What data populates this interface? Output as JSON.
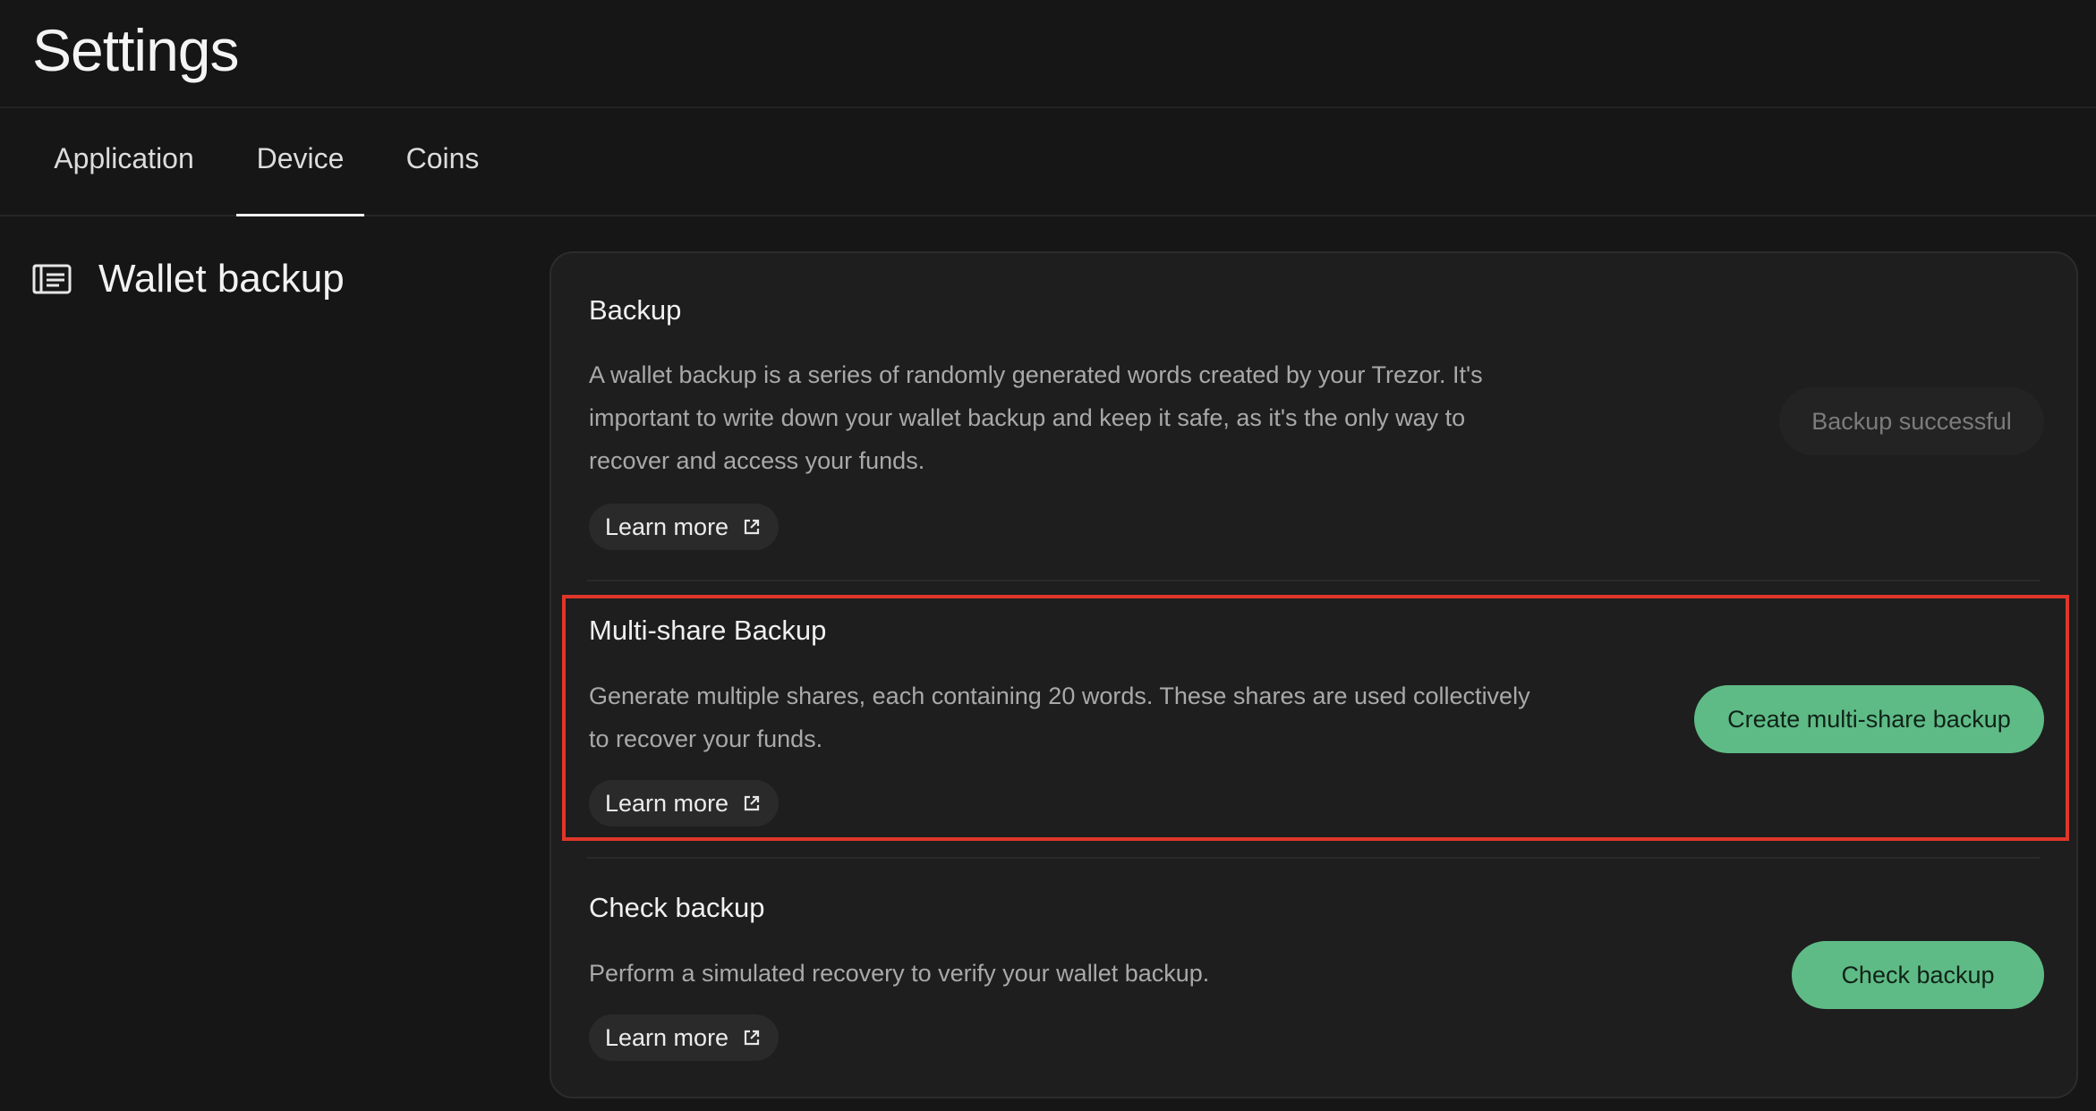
{
  "header": {
    "title": "Settings"
  },
  "tabs": [
    {
      "label": "Application",
      "active": false
    },
    {
      "label": "Device",
      "active": true
    },
    {
      "label": "Coins",
      "active": false
    }
  ],
  "section": {
    "icon": "wallet-backup-icon",
    "title": "Wallet backup"
  },
  "items": [
    {
      "title": "Backup",
      "description": "A wallet backup is a series of randomly generated words created by your Trezor. It's important to write down your wallet backup and keep it safe, as it's the only way to recover and access your funds.",
      "learn_more": "Learn more",
      "action": "Backup successful",
      "action_state": "disabled"
    },
    {
      "title": "Multi-share Backup",
      "description": "Generate multiple shares, each containing 20 words. These shares are used collectively to recover your funds.",
      "learn_more": "Learn more",
      "action": "Create multi-share backup",
      "action_state": "primary"
    },
    {
      "title": "Check backup",
      "description": "Perform a simulated recovery to verify your wallet backup.",
      "learn_more": "Learn more",
      "action": "Check backup",
      "action_state": "primary"
    }
  ],
  "colors": {
    "background": "#161616",
    "card": "#1e1e1e",
    "accent_green": "#5fbb86",
    "highlight_red": "#e0362a"
  }
}
